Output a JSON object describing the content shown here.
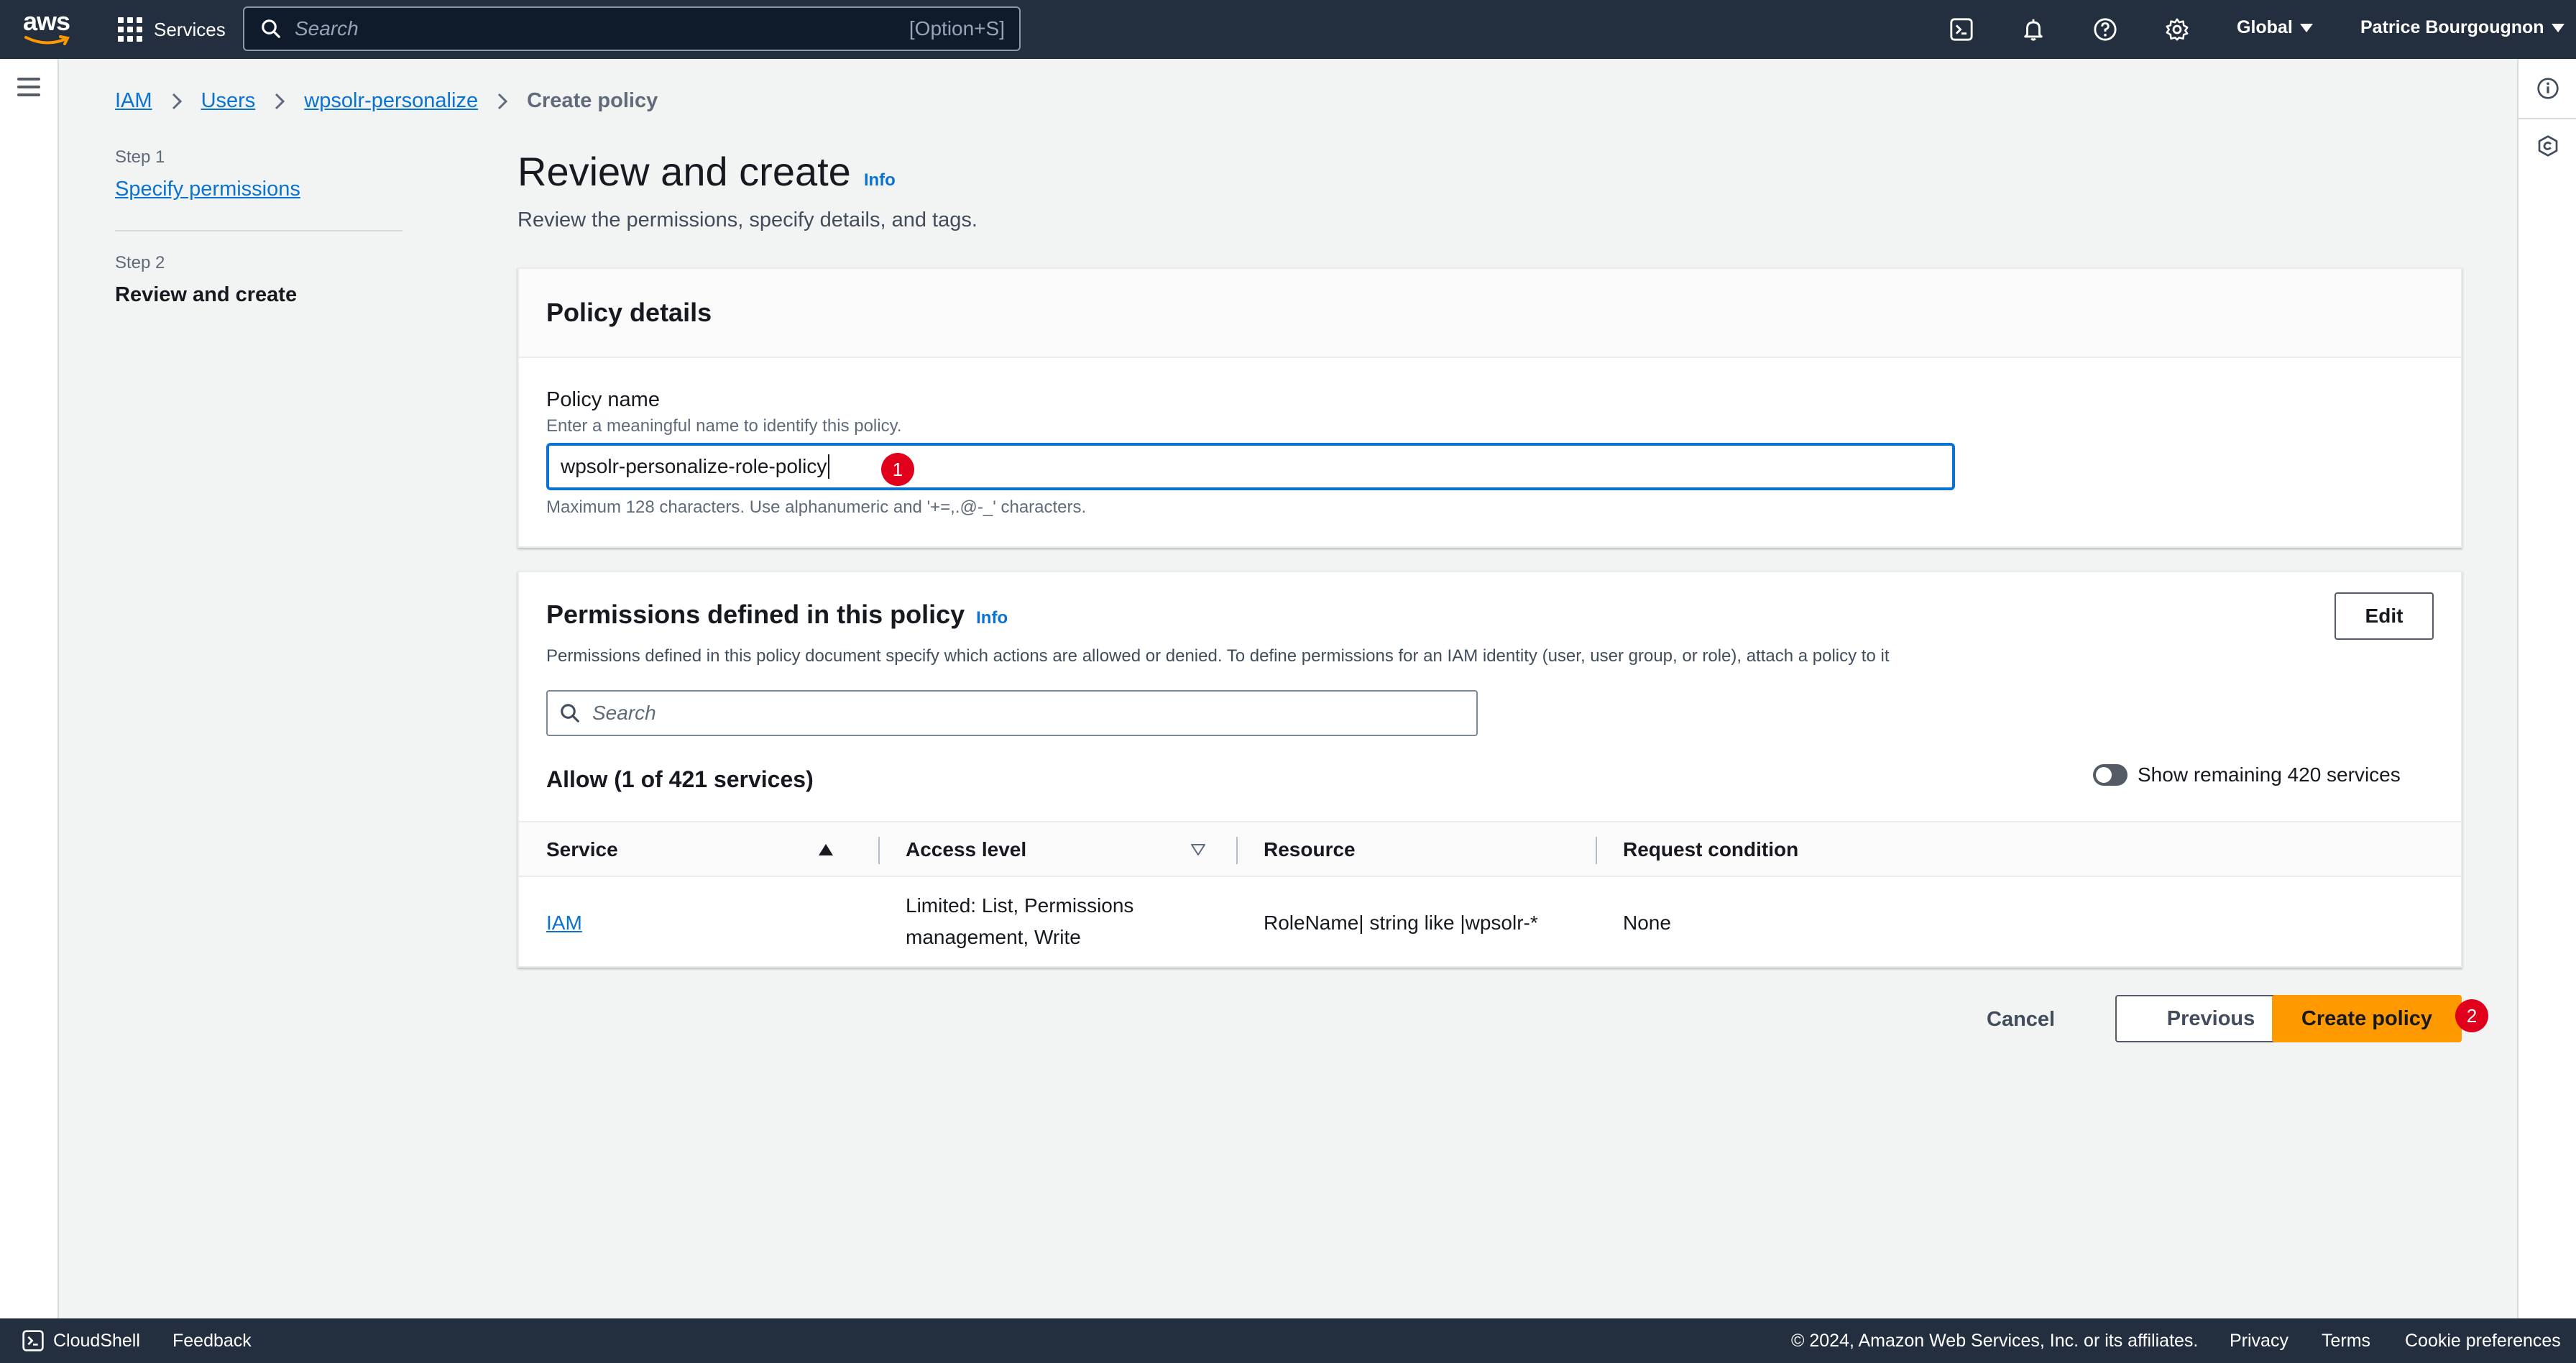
{
  "topnav": {
    "logo_text": "aws",
    "services_label": "Services",
    "search_placeholder": "Search",
    "search_shortcut": "[Option+S]",
    "region": "Global",
    "user": "Patrice Bourgougnon",
    "icons": [
      "cloudshell-icon",
      "bell-icon",
      "help-icon",
      "settings-icon"
    ]
  },
  "breadcrumb": {
    "items": [
      "IAM",
      "Users",
      "wpsolr-personalize"
    ],
    "current": "Create policy"
  },
  "steps": {
    "step1_label": "Step 1",
    "step1_title": "Specify permissions",
    "step2_label": "Step 2",
    "step2_title": "Review and create"
  },
  "header": {
    "title": "Review and create",
    "info": "Info",
    "description": "Review the permissions, specify details, and tags."
  },
  "policy_details": {
    "title": "Policy details",
    "name_label": "Policy name",
    "name_description": "Enter a meaningful name to identify this policy.",
    "name_value": "wpsolr-personalize-role-policy",
    "name_hint": "Maximum 128 characters. Use alphanumeric and '+=,.@-_' characters.",
    "annotation": "1"
  },
  "permissions": {
    "title": "Permissions defined in this policy",
    "info": "Info",
    "description": "Permissions defined in this policy document specify which actions are allowed or denied. To define permissions for an IAM identity (user, user group, or role), attach a policy to it",
    "edit_label": "Edit",
    "search_placeholder": "Search",
    "allow_title": "Allow (1 of 421 services)",
    "toggle_label": "Show remaining 420 services",
    "columns": [
      "Service",
      "Access level",
      "Resource",
      "Request condition"
    ],
    "rows": [
      {
        "service": "IAM",
        "access_line1": "Limited: List, Permissions",
        "access_line2": "management, Write",
        "resource": "RoleName| string like |wpsolr-*",
        "condition": "None"
      }
    ]
  },
  "actions": {
    "cancel": "Cancel",
    "previous": "Previous",
    "create": "Create policy",
    "annotation": "2"
  },
  "footer": {
    "cloudshell": "CloudShell",
    "feedback": "Feedback",
    "copyright": "© 2024, Amazon Web Services, Inc. or its affiliates.",
    "privacy": "Privacy",
    "terms": "Terms",
    "cookies": "Cookie preferences"
  },
  "colors": {
    "nav_bg": "#232f3e",
    "link": "#0972d3",
    "primary": "#ff9900",
    "annotation": "#e0001b"
  }
}
